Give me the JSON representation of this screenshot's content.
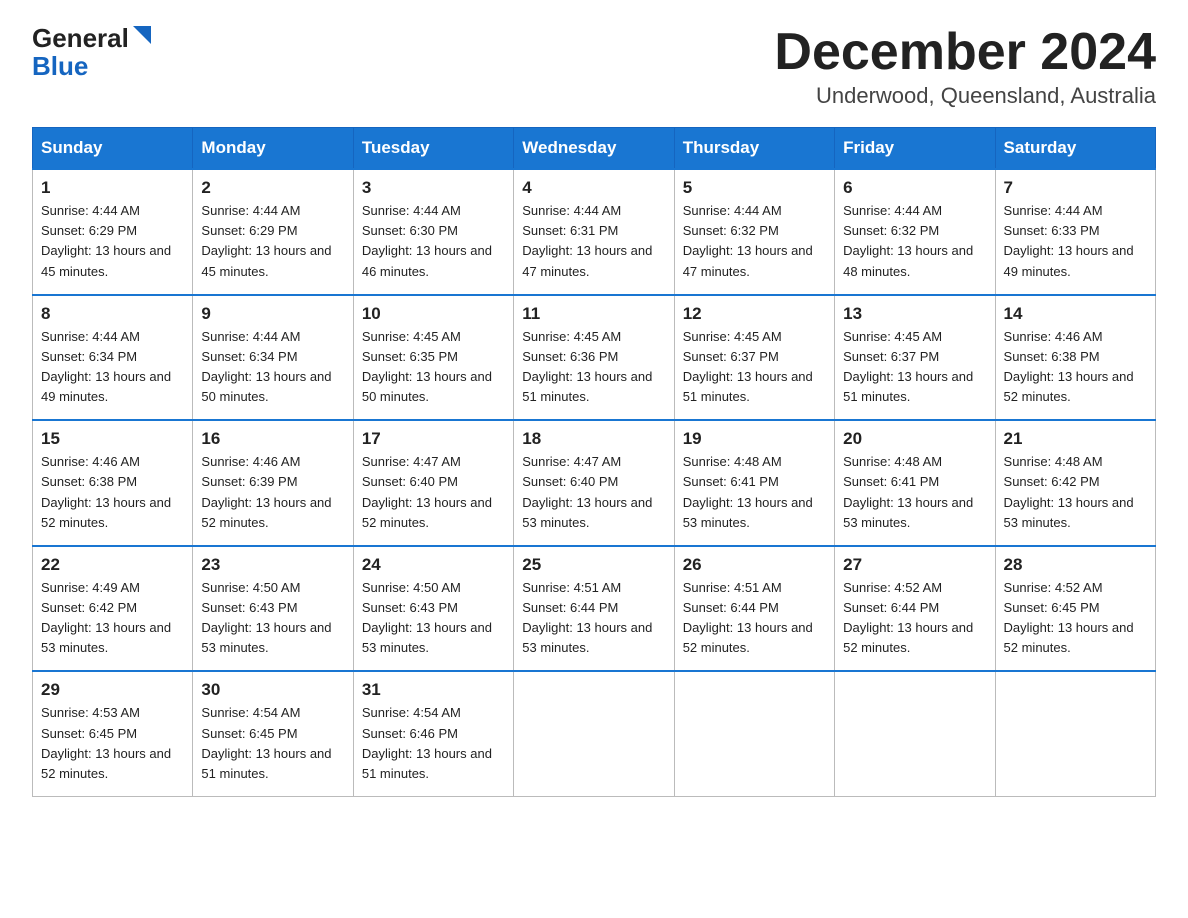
{
  "header": {
    "logo_general": "General",
    "logo_blue": "Blue",
    "month_title": "December 2024",
    "location": "Underwood, Queensland, Australia"
  },
  "weekdays": [
    "Sunday",
    "Monday",
    "Tuesday",
    "Wednesday",
    "Thursday",
    "Friday",
    "Saturday"
  ],
  "weeks": [
    [
      {
        "day": "1",
        "sunrise": "4:44 AM",
        "sunset": "6:29 PM",
        "daylight": "13 hours and 45 minutes."
      },
      {
        "day": "2",
        "sunrise": "4:44 AM",
        "sunset": "6:29 PM",
        "daylight": "13 hours and 45 minutes."
      },
      {
        "day": "3",
        "sunrise": "4:44 AM",
        "sunset": "6:30 PM",
        "daylight": "13 hours and 46 minutes."
      },
      {
        "day": "4",
        "sunrise": "4:44 AM",
        "sunset": "6:31 PM",
        "daylight": "13 hours and 47 minutes."
      },
      {
        "day": "5",
        "sunrise": "4:44 AM",
        "sunset": "6:32 PM",
        "daylight": "13 hours and 47 minutes."
      },
      {
        "day": "6",
        "sunrise": "4:44 AM",
        "sunset": "6:32 PM",
        "daylight": "13 hours and 48 minutes."
      },
      {
        "day": "7",
        "sunrise": "4:44 AM",
        "sunset": "6:33 PM",
        "daylight": "13 hours and 49 minutes."
      }
    ],
    [
      {
        "day": "8",
        "sunrise": "4:44 AM",
        "sunset": "6:34 PM",
        "daylight": "13 hours and 49 minutes."
      },
      {
        "day": "9",
        "sunrise": "4:44 AM",
        "sunset": "6:34 PM",
        "daylight": "13 hours and 50 minutes."
      },
      {
        "day": "10",
        "sunrise": "4:45 AM",
        "sunset": "6:35 PM",
        "daylight": "13 hours and 50 minutes."
      },
      {
        "day": "11",
        "sunrise": "4:45 AM",
        "sunset": "6:36 PM",
        "daylight": "13 hours and 51 minutes."
      },
      {
        "day": "12",
        "sunrise": "4:45 AM",
        "sunset": "6:37 PM",
        "daylight": "13 hours and 51 minutes."
      },
      {
        "day": "13",
        "sunrise": "4:45 AM",
        "sunset": "6:37 PM",
        "daylight": "13 hours and 51 minutes."
      },
      {
        "day": "14",
        "sunrise": "4:46 AM",
        "sunset": "6:38 PM",
        "daylight": "13 hours and 52 minutes."
      }
    ],
    [
      {
        "day": "15",
        "sunrise": "4:46 AM",
        "sunset": "6:38 PM",
        "daylight": "13 hours and 52 minutes."
      },
      {
        "day": "16",
        "sunrise": "4:46 AM",
        "sunset": "6:39 PM",
        "daylight": "13 hours and 52 minutes."
      },
      {
        "day": "17",
        "sunrise": "4:47 AM",
        "sunset": "6:40 PM",
        "daylight": "13 hours and 52 minutes."
      },
      {
        "day": "18",
        "sunrise": "4:47 AM",
        "sunset": "6:40 PM",
        "daylight": "13 hours and 53 minutes."
      },
      {
        "day": "19",
        "sunrise": "4:48 AM",
        "sunset": "6:41 PM",
        "daylight": "13 hours and 53 minutes."
      },
      {
        "day": "20",
        "sunrise": "4:48 AM",
        "sunset": "6:41 PM",
        "daylight": "13 hours and 53 minutes."
      },
      {
        "day": "21",
        "sunrise": "4:48 AM",
        "sunset": "6:42 PM",
        "daylight": "13 hours and 53 minutes."
      }
    ],
    [
      {
        "day": "22",
        "sunrise": "4:49 AM",
        "sunset": "6:42 PM",
        "daylight": "13 hours and 53 minutes."
      },
      {
        "day": "23",
        "sunrise": "4:50 AM",
        "sunset": "6:43 PM",
        "daylight": "13 hours and 53 minutes."
      },
      {
        "day": "24",
        "sunrise": "4:50 AM",
        "sunset": "6:43 PM",
        "daylight": "13 hours and 53 minutes."
      },
      {
        "day": "25",
        "sunrise": "4:51 AM",
        "sunset": "6:44 PM",
        "daylight": "13 hours and 53 minutes."
      },
      {
        "day": "26",
        "sunrise": "4:51 AM",
        "sunset": "6:44 PM",
        "daylight": "13 hours and 52 minutes."
      },
      {
        "day": "27",
        "sunrise": "4:52 AM",
        "sunset": "6:44 PM",
        "daylight": "13 hours and 52 minutes."
      },
      {
        "day": "28",
        "sunrise": "4:52 AM",
        "sunset": "6:45 PM",
        "daylight": "13 hours and 52 minutes."
      }
    ],
    [
      {
        "day": "29",
        "sunrise": "4:53 AM",
        "sunset": "6:45 PM",
        "daylight": "13 hours and 52 minutes."
      },
      {
        "day": "30",
        "sunrise": "4:54 AM",
        "sunset": "6:45 PM",
        "daylight": "13 hours and 51 minutes."
      },
      {
        "day": "31",
        "sunrise": "4:54 AM",
        "sunset": "6:46 PM",
        "daylight": "13 hours and 51 minutes."
      },
      null,
      null,
      null,
      null
    ]
  ]
}
